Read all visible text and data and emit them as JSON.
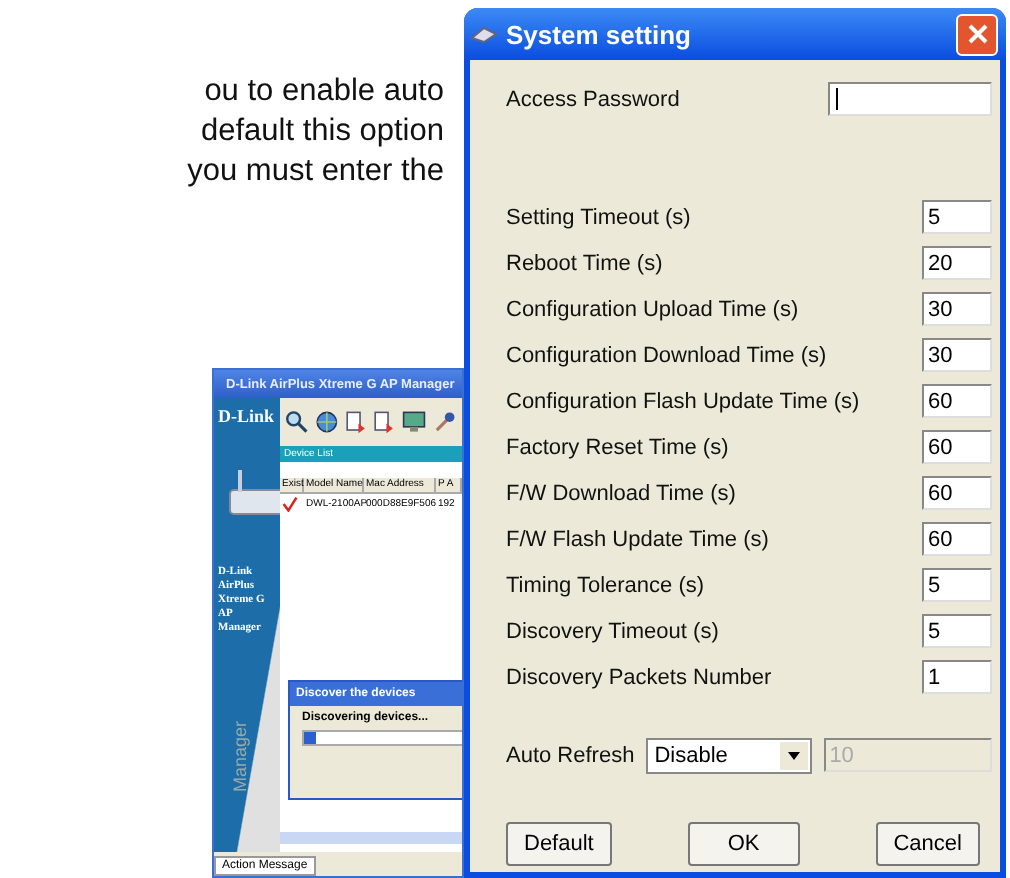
{
  "document_text": [
    "ou to enable auto",
    "default this option",
    "you must enter the"
  ],
  "manager_window": {
    "title": "D-Link AirPlus Xtreme G AP Manager",
    "logo": "D-Link",
    "side_text": [
      "D-Link",
      "AirPlus",
      "Xtreme G",
      "AP",
      "Manager"
    ],
    "side_watermark": "Manager",
    "device_list_label": "Device List",
    "columns": [
      "Exist",
      "Model Name",
      "Mac Address",
      "P A"
    ],
    "rows": [
      {
        "exist": true,
        "model": "DWL-2100AP",
        "mac": "000D88E9F506",
        "ip": "192"
      }
    ],
    "progress_dialog": {
      "title": "Discover the devices",
      "message": "Discovering devices...",
      "level": 0.06
    },
    "status_tab": "Action Message"
  },
  "dialog": {
    "title": "System setting",
    "password": {
      "label": "Access Password"
    },
    "fields": [
      {
        "label": "Setting Timeout (s)",
        "value": "5"
      },
      {
        "label": "Reboot Time (s)",
        "value": "20"
      },
      {
        "label": "Configuration Upload Time (s)",
        "value": "30"
      },
      {
        "label": "Configuration Download Time (s)",
        "value": "30"
      },
      {
        "label": "Configuration Flash Update Time (s)",
        "value": "60"
      },
      {
        "label": "Factory Reset Time (s)",
        "value": "60"
      },
      {
        "label": "F/W Download Time (s)",
        "value": "60"
      },
      {
        "label": "F/W Flash Update Time (s)",
        "value": "60"
      },
      {
        "label": "Timing Tolerance (s)",
        "value": "5"
      },
      {
        "label": "Discovery Timeout (s)",
        "value": "5"
      },
      {
        "label": "Discovery Packets Number",
        "value": "1"
      }
    ],
    "auto_refresh": {
      "label": "Auto Refresh",
      "value": "Disable",
      "interval": "10",
      "interval_disabled": true
    },
    "buttons": [
      "Default",
      "OK",
      "Cancel"
    ]
  }
}
